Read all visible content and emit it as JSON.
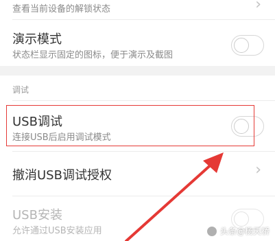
{
  "top_row": {
    "subtitle": "查看当前设备的解锁状态"
  },
  "demo_mode": {
    "title": "演示模式",
    "subtitle": "状态栏显示固定的图标，便于演示及截图",
    "toggle_on": false
  },
  "section": {
    "label": "调试"
  },
  "usb_debugging": {
    "title": "USB调试",
    "subtitle": "连接USB后启用调试模式",
    "toggle_on": false
  },
  "revoke_usb": {
    "title": "撤消USB调试授权"
  },
  "usb_install": {
    "title": "USB安装",
    "subtitle": "允许通过USB安装应用",
    "toggle_on": false,
    "enabled": false
  },
  "annotation": {
    "color": "#e53935"
  },
  "watermark": {
    "text": "头条@杨天桥"
  }
}
